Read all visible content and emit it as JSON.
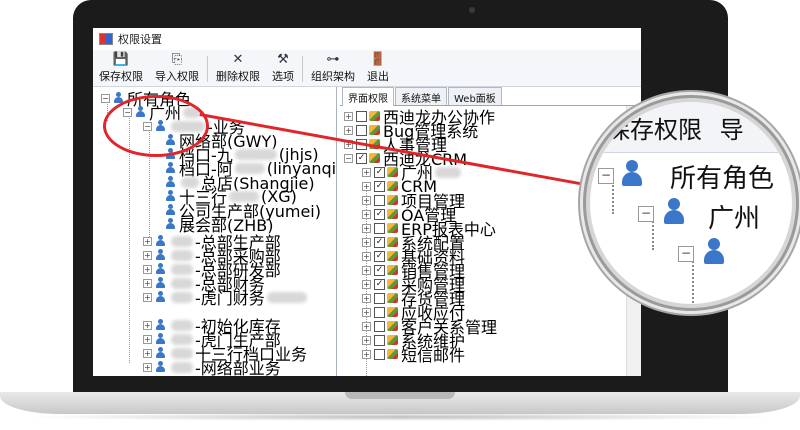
{
  "window": {
    "title": "权限设置"
  },
  "toolbar": {
    "save": "保存权限",
    "import": "导入权限",
    "delete": "删除权限",
    "options": "选项",
    "org": "组织架构",
    "exit": "退出"
  },
  "tree": {
    "root": "所有角色",
    "company": "广州",
    "dept_business": "-业务",
    "nodes": [
      "网络部(GWY)",
      "档口-九",
      "(jhjs)",
      "档口-阿",
      "(linyanqi",
      "总店(Shangjie)",
      "十三行",
      "(XG)",
      "公司生产部(yumei)",
      "展会部(ZHB)"
    ],
    "groups": [
      "-总部生产部",
      "-总部采购部",
      "-总部研发部",
      "-总部财务",
      "-虎门财务",
      "-初始化库存",
      "-虎门生产部",
      "十三行档口业务",
      "-网络部业务"
    ]
  },
  "tabs": [
    "界面权限",
    "系统菜单",
    "Web面板"
  ],
  "modules": {
    "top": [
      "西迪龙办公协作",
      "Bug管理系统",
      "人事管理",
      "西迪龙CRM"
    ],
    "crm": [
      "广州",
      "CRM",
      "项目管理",
      "OA管理",
      "ERP报表中心",
      "系统配置",
      "基础资料",
      "销售管理",
      "采购管理",
      "存货管理",
      "应收应付",
      "客户关系管理",
      "系统维护",
      "短信邮件"
    ]
  },
  "magnifier": {
    "save": "保存权限",
    "save_next": "导",
    "root": "所有角色",
    "company": "广州"
  }
}
